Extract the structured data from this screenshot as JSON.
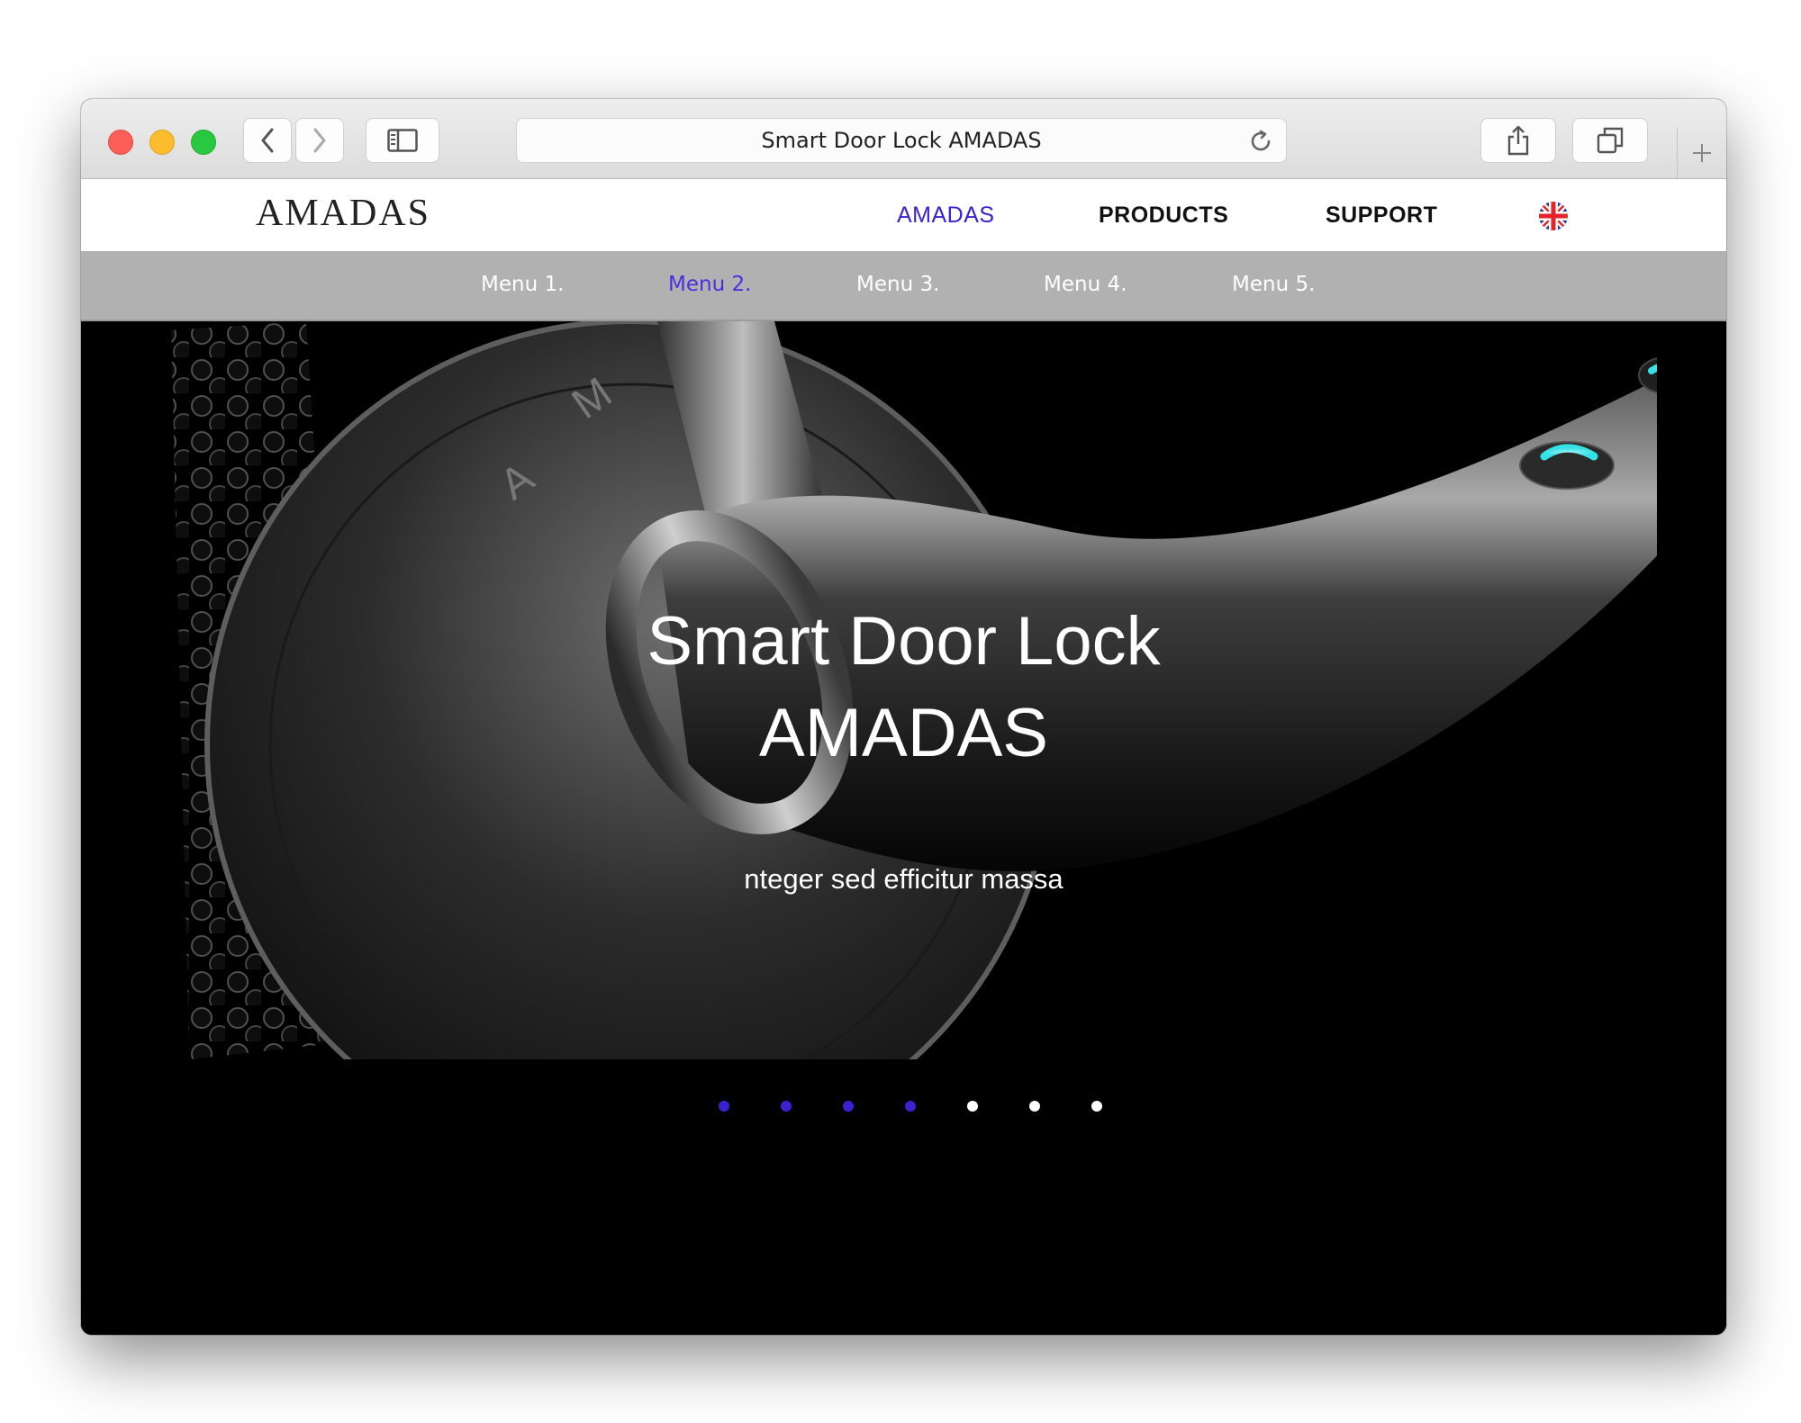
{
  "browser": {
    "url_text": "Smart Door Lock AMADAS"
  },
  "header": {
    "logo": "AMADAS",
    "nav": [
      {
        "label": "AMADAS",
        "active": true
      },
      {
        "label": "PRODUCTS",
        "active": false
      },
      {
        "label": "SUPPORT",
        "active": false
      }
    ],
    "language_flag": "uk-flag-icon"
  },
  "submenu": {
    "items": [
      "Menu 1.",
      "Menu 2.",
      "Menu 3.",
      "Menu 4.",
      "Menu 5."
    ],
    "active_index": 1
  },
  "hero": {
    "title_line1": "Smart Door Lock",
    "title_line2": "AMADAS",
    "subtitle": "nteger sed efficitur massa"
  },
  "slider": {
    "dot_count": 7,
    "active_count": 4
  },
  "colors": {
    "accent": "#3c21d2",
    "submenu_bg": "#b1b1b1",
    "hero_bg": "#000000",
    "led": "#35e0e6"
  }
}
